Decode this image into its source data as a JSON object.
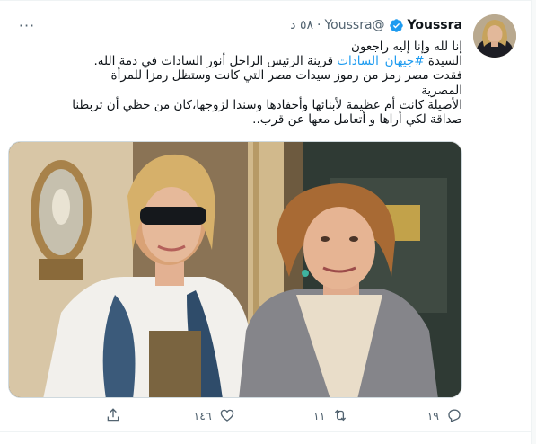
{
  "tweet": {
    "author_name": "Youssra",
    "handle": "@Youssra",
    "separator": "·",
    "time": "٥٨ د",
    "more_label": "···",
    "lines": [
      "إنا لله وإنا إليه راجعون",
      "قرينة الرئيس الراحل أنور السادات في ذمة الله.",
      "فقدت مصر رمز من رموز سيدات مصر التي كانت وستظل رمزا للمرأة المصرية",
      "الأصيلة كانت أم عظيمة لأبنائها وأحفادها وسندا لزوجها،كان من حظي أن تربطنا",
      "صداقة لكي أراها و أتعامل معها عن قرب.."
    ],
    "line2_prefix": "السيدة ",
    "hashtag": "#جيهان_السادات",
    "actions": {
      "reply_count": "١٩",
      "retweet_count": "١١",
      "like_count": "١٤٦",
      "share_count": ""
    }
  },
  "colors": {
    "accent": "#1d9bf0",
    "secondary_text": "#536471",
    "primary_text": "#0f1419",
    "border": "#cfd9de"
  },
  "icons": {
    "verified": "verified-badge-icon",
    "reply": "reply-icon",
    "retweet": "retweet-icon",
    "like": "heart-icon",
    "share": "share-icon",
    "more": "more-options-icon"
  }
}
